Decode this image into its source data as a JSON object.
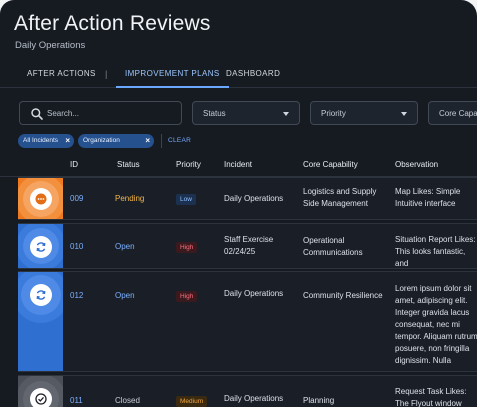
{
  "header": {
    "title": "After Action Reviews",
    "subtitle": "Daily Operations"
  },
  "tabs": [
    {
      "label": "AFTER ACTIONS",
      "active": false
    },
    {
      "label": "IMPROVEMENT PLANS",
      "active": true
    },
    {
      "label": "DASHBOARD",
      "active": false
    }
  ],
  "tab_separator": "|",
  "search": {
    "placeholder": "Search...",
    "value": ""
  },
  "filters": [
    {
      "label": "Status"
    },
    {
      "label": "Priority"
    },
    {
      "label": "Core Capability"
    }
  ],
  "chips": [
    {
      "label": "All Incidents"
    },
    {
      "label": "Organization"
    }
  ],
  "clear_label": "CLEAR",
  "columns": [
    "ID",
    "Status",
    "Priority",
    "Incident",
    "Core Capability",
    "Observation"
  ],
  "rows": [
    {
      "id": "009",
      "status": "Pending",
      "priority": "Low",
      "incident": "Daily Operations",
      "capability": "Logistics and Supply Side Management",
      "observation": "Map Likes: Simple Intuitive interface"
    },
    {
      "id": "010",
      "status": "Open",
      "priority": "High",
      "incident": "Staff Exercise 02/24/25",
      "capability": "Operational Communications",
      "observation": "Situation Report Likes: This looks fantastic, and"
    },
    {
      "id": "012",
      "status": "Open",
      "priority": "High",
      "incident": "Daily Operations",
      "capability": "Community Resilience",
      "observation": "Lorem ipsum dolor sit amet, adipiscing elit. Integer gravida lacus consequat, nec mi tempor. Aliquam rutrum posuere, non fringilla dignissim. Nulla consequat neque gravida. Proin volutpat ut"
    },
    {
      "id": "011",
      "status": "Closed",
      "priority": "Medium",
      "incident": "Daily Operations",
      "capability": "Planning",
      "observation": "Request Task Likes: The Flyout window here"
    }
  ],
  "colors": {
    "background": "#161b22",
    "accent": "#6aa8ff",
    "pending_thumb": "#f07a1f",
    "open_thumb": "#2f6fd0",
    "closed_thumb": "#4a4f57"
  },
  "icons": [
    "search-icon",
    "close-icon",
    "chevron-down-icon",
    "ellipsis-icon",
    "refresh-icon",
    "check-icon"
  ]
}
